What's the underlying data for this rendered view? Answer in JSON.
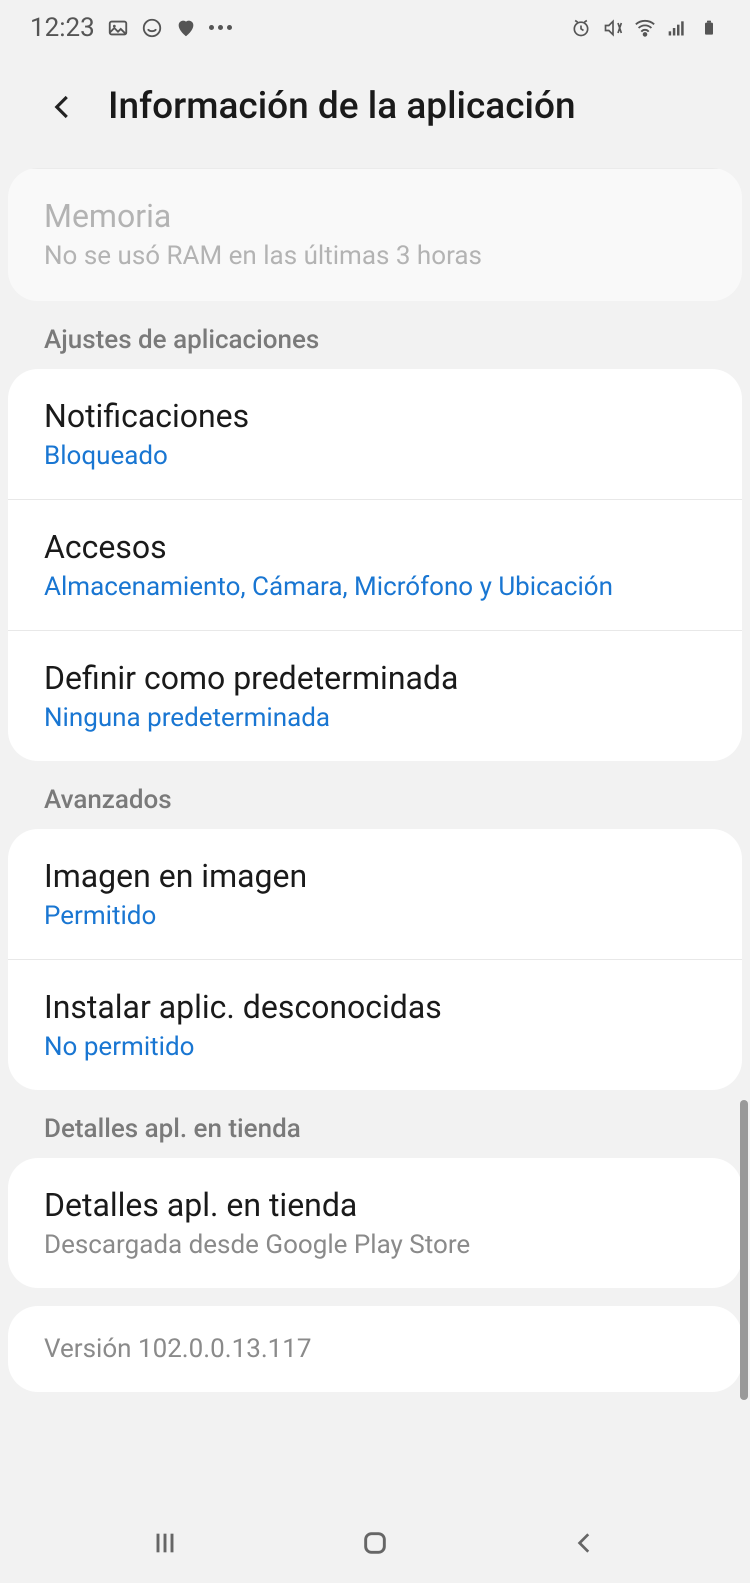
{
  "statusBar": {
    "time": "12:23"
  },
  "header": {
    "title": "Información de la aplicación"
  },
  "memory": {
    "title": "Memoria",
    "subtitle": "No se usó RAM en las últimas 3 horas"
  },
  "sections": {
    "appSettings": {
      "header": "Ajustes de aplicaciones",
      "items": [
        {
          "title": "Notificaciones",
          "subtitle": "Bloqueado"
        },
        {
          "title": "Accesos",
          "subtitle": "Almacenamiento, Cámara, Micrófono y Ubicación"
        },
        {
          "title": "Definir como predeterminada",
          "subtitle": "Ninguna predeterminada"
        }
      ]
    },
    "advanced": {
      "header": "Avanzados",
      "items": [
        {
          "title": "Imagen en imagen",
          "subtitle": "Permitido"
        },
        {
          "title": "Instalar aplic. desconocidas",
          "subtitle": "No permitido"
        }
      ]
    },
    "storeDetails": {
      "header": "Detalles apl. en tienda",
      "items": [
        {
          "title": "Detalles apl. en tienda",
          "subtitle": "Descargada desde Google Play Store"
        }
      ]
    }
  },
  "version": "Versión 102.0.0.13.117"
}
